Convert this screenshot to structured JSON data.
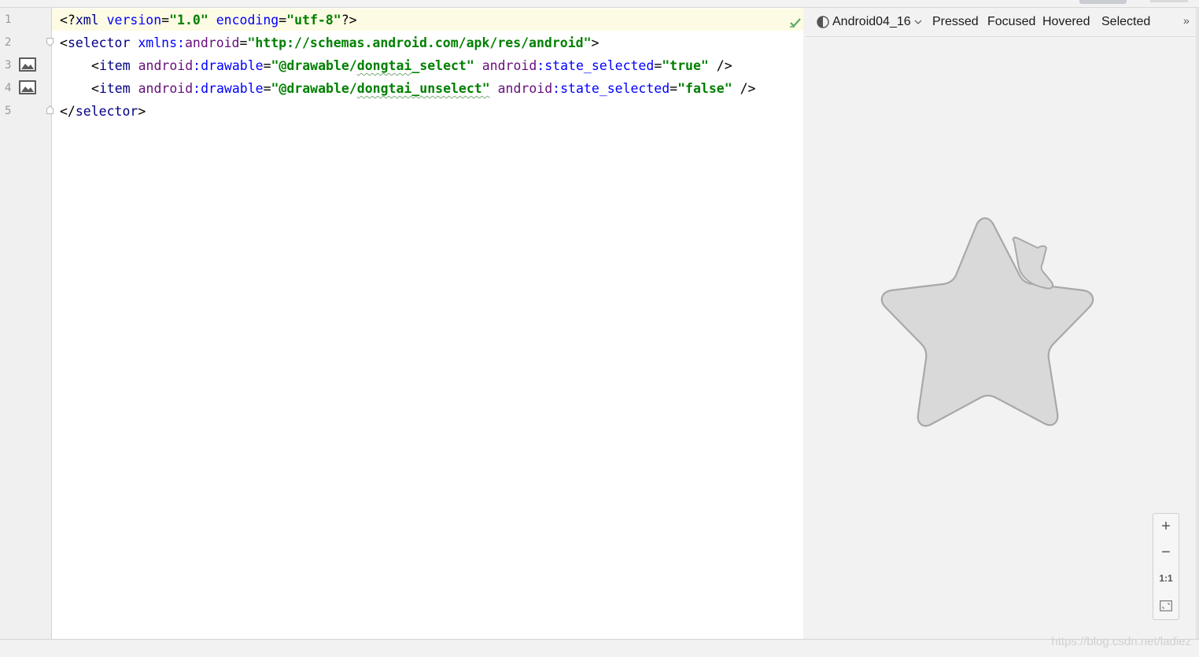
{
  "editor": {
    "line_numbers": [
      "1",
      "2",
      "3",
      "4",
      "5"
    ],
    "line1": {
      "p1": "<?",
      "p2": "xml ",
      "p3": "version",
      "p4": "=",
      "p5": "\"1.0\"",
      "p6": " ",
      "p7": "encoding",
      "p8": "=",
      "p9": "\"utf-8\"",
      "p10": "?>"
    },
    "line2": {
      "p1": "<",
      "p2": "selector ",
      "p3": "xmlns:",
      "p4": "android",
      "p5": "=",
      "p6": "\"http://schemas.android.com/apk/res/android\"",
      "p7": ">"
    },
    "line3": {
      "p1": "<",
      "p2": "item ",
      "p3": "android",
      "p4": ":drawable",
      "p5": "=",
      "p6": "\"@drawable/",
      "p7": "dongtai",
      "p8": "_select\"",
      "p9": " ",
      "p10": "android",
      "p11": ":state_selected",
      "p12": "=",
      "p13": "\"true\"",
      "p14": " />"
    },
    "line4": {
      "p1": "<",
      "p2": "item ",
      "p3": "android",
      "p4": ":drawable",
      "p5": "=",
      "p6": "\"@drawable/",
      "p7": "dongtai",
      "p8": "_unselect\"",
      "p9": " ",
      "p10": "android",
      "p11": ":state_selected",
      "p12": "=",
      "p13": "\"false\"",
      "p14": " />"
    },
    "line5": {
      "p1": "</",
      "p2": "selector",
      "p3": ">"
    }
  },
  "preview": {
    "theme": "Android04_16",
    "states": [
      "Pressed",
      "Focused",
      "Hovered",
      "Selected"
    ],
    "more": "»",
    "zoom": {
      "zoom_in": "+",
      "zoom_out": "−",
      "actual_size": "1:1"
    }
  },
  "watermark": "https://blog.csdn.net/ladiez",
  "colors": {
    "tag": "#000080",
    "attribute": "#0000ff",
    "namespace": "#660e7a",
    "string": "#008000",
    "current_line": "#fdfbe3",
    "star_fill": "#d9d9d9",
    "star_stroke": "#a8a8a8"
  },
  "icons": [
    "image-icon",
    "fold-icon",
    "check-icon",
    "theme-icon",
    "chevron-down-icon",
    "zoom-in-icon",
    "zoom-out-icon",
    "fit-screen-icon"
  ]
}
